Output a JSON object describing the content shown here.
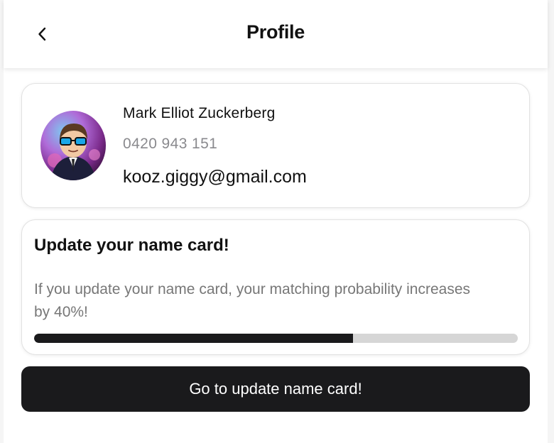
{
  "header": {
    "title": "Profile",
    "back_icon": "chevron-left-icon"
  },
  "profile": {
    "name": "Mark Elliot Zuckerberg",
    "phone": "0420 943 151",
    "email": "kooz.giggy@gmail.com"
  },
  "name_card_prompt": {
    "title": "Update your name card!",
    "description": "If you update your name card, your matching probability increases by 40%!",
    "progress_percent": 66
  },
  "cta": {
    "label": "Go to update name card!"
  },
  "colors": {
    "primary": "#1a1a1c",
    "muted_text": "#777777",
    "track": "#d6d6d6"
  }
}
